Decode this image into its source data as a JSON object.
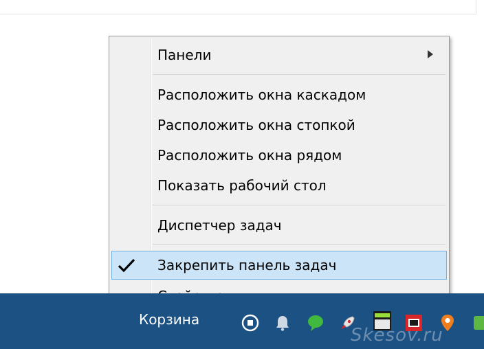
{
  "context_menu": {
    "items": [
      {
        "label": "Панели",
        "has_submenu": true
      },
      {
        "label": "Расположить окна каскадом"
      },
      {
        "label": "Расположить окна стопкой"
      },
      {
        "label": "Расположить окна рядом"
      },
      {
        "label": "Показать рабочий стол"
      },
      {
        "label": "Диспетчер задач"
      },
      {
        "label": "Закрепить панель задач",
        "checked": true,
        "highlighted": true
      },
      {
        "label": "Свойства"
      }
    ]
  },
  "taskbar": {
    "label": "Корзина",
    "tray_icons": [
      "record-icon",
      "bell-icon",
      "chat-bubble-icon",
      "rocket-icon",
      "fps-icon",
      "sb-icon",
      "location-pin-icon",
      "app-icon"
    ],
    "watermark": "Skesov.ru"
  },
  "colors": {
    "taskbar": "#1c5184",
    "menu_bg": "#f0f0f0",
    "highlight_bg": "#cce4f7",
    "highlight_border": "#6fb2e6"
  }
}
